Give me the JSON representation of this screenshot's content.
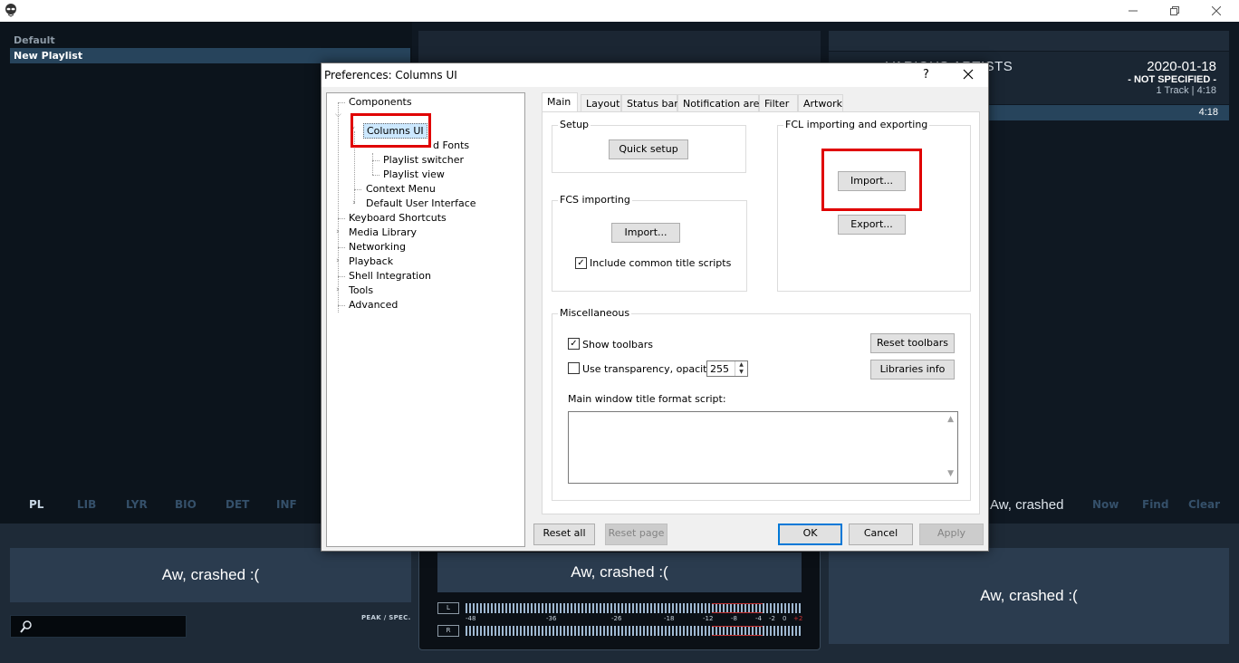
{
  "window": {
    "min_icon": "minimize-icon",
    "max_icon": "restore-icon",
    "close_icon": "close-icon"
  },
  "playlists": {
    "items": [
      "Default",
      "New Playlist"
    ]
  },
  "now_playing": {
    "artist": "VARIOUS ARTISTS",
    "date": "2020-01-18",
    "genre": "- NOT SPECIFIED -",
    "tracks": "1 Track | 4:18",
    "length": "4:18"
  },
  "left_tabs": [
    "PL",
    "LIB",
    "LYR",
    "BIO",
    "DET",
    "INF"
  ],
  "right_tabs": {
    "crash_text": "Aw, crashed",
    "items": [
      "Now",
      "Find",
      "Clear"
    ]
  },
  "panels": {
    "crash_left": "Aw, crashed :(",
    "crash_center": "Aw, crashed :(",
    "crash_right": "Aw, crashed :("
  },
  "meter": {
    "peak_label": "PEAK / SPEC.",
    "left_label": "L",
    "right_label": "R",
    "scale": [
      "-48",
      "-36",
      "-26",
      "-18",
      "-12",
      "-8",
      "-4",
      "-2",
      "0",
      "+2"
    ]
  },
  "dialog": {
    "title": "Preferences: Columns UI",
    "help": "?",
    "tree": {
      "components": "Components",
      "columns_ui": "Columns UI",
      "colours_fonts": "d Fonts",
      "playlist_switcher": "Playlist switcher",
      "playlist_view": "Playlist view",
      "context_menu": "Context Menu",
      "default_ui": "Default User Interface",
      "keyboard": "Keyboard Shortcuts",
      "media_library": "Media Library",
      "networking": "Networking",
      "playback": "Playback",
      "shell": "Shell Integration",
      "tools": "Tools",
      "advanced": "Advanced"
    },
    "tabs": [
      "Main",
      "Layout",
      "Status bar",
      "Notification area",
      "Filter",
      "Artwork"
    ],
    "setup": {
      "label": "Setup",
      "quick_setup": "Quick setup"
    },
    "fcs": {
      "label": "FCS importing",
      "import": "Import...",
      "include_scripts": "Include common title scripts",
      "include_checked": true
    },
    "fcl": {
      "label": "FCL importing and exporting",
      "import": "Import...",
      "export": "Export..."
    },
    "misc": {
      "label": "Miscellaneous",
      "show_toolbars": "Show toolbars",
      "show_toolbars_checked": true,
      "use_transparency": "Use transparency, opacity",
      "use_transparency_checked": false,
      "opacity": "255",
      "reset_toolbars": "Reset toolbars",
      "libraries_info": "Libraries info",
      "title_format_label": "Main window title format script:",
      "title_format_value": ""
    },
    "buttons": {
      "reset_all": "Reset all",
      "reset_page": "Reset page",
      "ok": "OK",
      "cancel": "Cancel",
      "apply": "Apply"
    }
  }
}
